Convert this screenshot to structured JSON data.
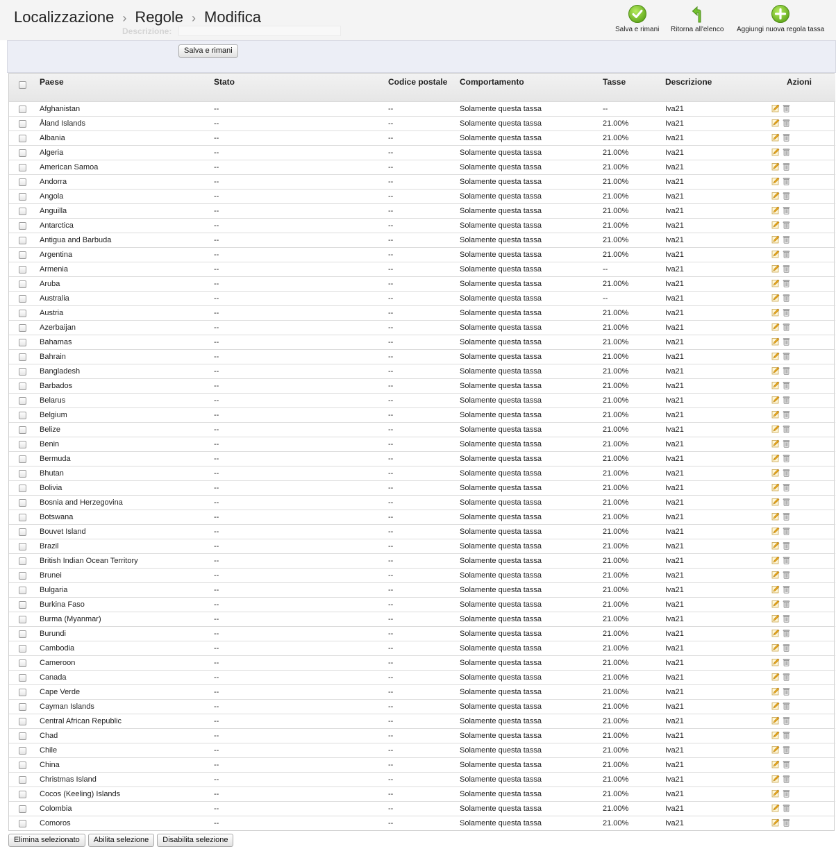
{
  "header": {
    "ghost_field_label": "Descrizione:",
    "breadcrumb": [
      "Localizzazione",
      "Regole",
      "Modifica"
    ],
    "separator": "›",
    "toolbar": [
      {
        "label": "Salva e rimani",
        "icon": "check-icon",
        "color": "#7cc427"
      },
      {
        "label": "Ritorna all'elenco",
        "icon": "back-arrow-icon",
        "color": "#6ab82a"
      },
      {
        "label": "Aggiungi nuova regola tassa",
        "icon": "plus-circle-icon",
        "color": "#7cc427"
      }
    ]
  },
  "form": {
    "save_button": "Salva e rimani"
  },
  "table": {
    "headers": {
      "country": "Paese",
      "state": "Stato",
      "zip": "Codice postale",
      "behavior": "Comportamento",
      "tax": "Tasse",
      "description": "Descrizione",
      "actions": "Azioni"
    },
    "rows": [
      {
        "country": "Afghanistan",
        "state": "--",
        "zip": "--",
        "behavior": "Solamente questa tassa",
        "tax": "--",
        "description": "Iva21"
      },
      {
        "country": "Åland Islands",
        "state": "--",
        "zip": "--",
        "behavior": "Solamente questa tassa",
        "tax": "21.00%",
        "description": "Iva21"
      },
      {
        "country": "Albania",
        "state": "--",
        "zip": "--",
        "behavior": "Solamente questa tassa",
        "tax": "21.00%",
        "description": "Iva21"
      },
      {
        "country": "Algeria",
        "state": "--",
        "zip": "--",
        "behavior": "Solamente questa tassa",
        "tax": "21.00%",
        "description": "Iva21"
      },
      {
        "country": "American Samoa",
        "state": "--",
        "zip": "--",
        "behavior": "Solamente questa tassa",
        "tax": "21.00%",
        "description": "Iva21"
      },
      {
        "country": "Andorra",
        "state": "--",
        "zip": "--",
        "behavior": "Solamente questa tassa",
        "tax": "21.00%",
        "description": "Iva21"
      },
      {
        "country": "Angola",
        "state": "--",
        "zip": "--",
        "behavior": "Solamente questa tassa",
        "tax": "21.00%",
        "description": "Iva21"
      },
      {
        "country": "Anguilla",
        "state": "--",
        "zip": "--",
        "behavior": "Solamente questa tassa",
        "tax": "21.00%",
        "description": "Iva21"
      },
      {
        "country": "Antarctica",
        "state": "--",
        "zip": "--",
        "behavior": "Solamente questa tassa",
        "tax": "21.00%",
        "description": "Iva21"
      },
      {
        "country": "Antigua and Barbuda",
        "state": "--",
        "zip": "--",
        "behavior": "Solamente questa tassa",
        "tax": "21.00%",
        "description": "Iva21"
      },
      {
        "country": "Argentina",
        "state": "--",
        "zip": "--",
        "behavior": "Solamente questa tassa",
        "tax": "21.00%",
        "description": "Iva21"
      },
      {
        "country": "Armenia",
        "state": "--",
        "zip": "--",
        "behavior": "Solamente questa tassa",
        "tax": "--",
        "description": "Iva21"
      },
      {
        "country": "Aruba",
        "state": "--",
        "zip": "--",
        "behavior": "Solamente questa tassa",
        "tax": "21.00%",
        "description": "Iva21"
      },
      {
        "country": "Australia",
        "state": "--",
        "zip": "--",
        "behavior": "Solamente questa tassa",
        "tax": "--",
        "description": "Iva21"
      },
      {
        "country": "Austria",
        "state": "--",
        "zip": "--",
        "behavior": "Solamente questa tassa",
        "tax": "21.00%",
        "description": "Iva21"
      },
      {
        "country": "Azerbaijan",
        "state": "--",
        "zip": "--",
        "behavior": "Solamente questa tassa",
        "tax": "21.00%",
        "description": "Iva21"
      },
      {
        "country": "Bahamas",
        "state": "--",
        "zip": "--",
        "behavior": "Solamente questa tassa",
        "tax": "21.00%",
        "description": "Iva21"
      },
      {
        "country": "Bahrain",
        "state": "--",
        "zip": "--",
        "behavior": "Solamente questa tassa",
        "tax": "21.00%",
        "description": "Iva21"
      },
      {
        "country": "Bangladesh",
        "state": "--",
        "zip": "--",
        "behavior": "Solamente questa tassa",
        "tax": "21.00%",
        "description": "Iva21"
      },
      {
        "country": "Barbados",
        "state": "--",
        "zip": "--",
        "behavior": "Solamente questa tassa",
        "tax": "21.00%",
        "description": "Iva21"
      },
      {
        "country": "Belarus",
        "state": "--",
        "zip": "--",
        "behavior": "Solamente questa tassa",
        "tax": "21.00%",
        "description": "Iva21"
      },
      {
        "country": "Belgium",
        "state": "--",
        "zip": "--",
        "behavior": "Solamente questa tassa",
        "tax": "21.00%",
        "description": "Iva21"
      },
      {
        "country": "Belize",
        "state": "--",
        "zip": "--",
        "behavior": "Solamente questa tassa",
        "tax": "21.00%",
        "description": "Iva21"
      },
      {
        "country": "Benin",
        "state": "--",
        "zip": "--",
        "behavior": "Solamente questa tassa",
        "tax": "21.00%",
        "description": "Iva21"
      },
      {
        "country": "Bermuda",
        "state": "--",
        "zip": "--",
        "behavior": "Solamente questa tassa",
        "tax": "21.00%",
        "description": "Iva21"
      },
      {
        "country": "Bhutan",
        "state": "--",
        "zip": "--",
        "behavior": "Solamente questa tassa",
        "tax": "21.00%",
        "description": "Iva21"
      },
      {
        "country": "Bolivia",
        "state": "--",
        "zip": "--",
        "behavior": "Solamente questa tassa",
        "tax": "21.00%",
        "description": "Iva21"
      },
      {
        "country": "Bosnia and Herzegovina",
        "state": "--",
        "zip": "--",
        "behavior": "Solamente questa tassa",
        "tax": "21.00%",
        "description": "Iva21"
      },
      {
        "country": "Botswana",
        "state": "--",
        "zip": "--",
        "behavior": "Solamente questa tassa",
        "tax": "21.00%",
        "description": "Iva21"
      },
      {
        "country": "Bouvet Island",
        "state": "--",
        "zip": "--",
        "behavior": "Solamente questa tassa",
        "tax": "21.00%",
        "description": "Iva21"
      },
      {
        "country": "Brazil",
        "state": "--",
        "zip": "--",
        "behavior": "Solamente questa tassa",
        "tax": "21.00%",
        "description": "Iva21"
      },
      {
        "country": "British Indian Ocean Territory",
        "state": "--",
        "zip": "--",
        "behavior": "Solamente questa tassa",
        "tax": "21.00%",
        "description": "Iva21"
      },
      {
        "country": "Brunei",
        "state": "--",
        "zip": "--",
        "behavior": "Solamente questa tassa",
        "tax": "21.00%",
        "description": "Iva21"
      },
      {
        "country": "Bulgaria",
        "state": "--",
        "zip": "--",
        "behavior": "Solamente questa tassa",
        "tax": "21.00%",
        "description": "Iva21"
      },
      {
        "country": "Burkina Faso",
        "state": "--",
        "zip": "--",
        "behavior": "Solamente questa tassa",
        "tax": "21.00%",
        "description": "Iva21"
      },
      {
        "country": "Burma (Myanmar)",
        "state": "--",
        "zip": "--",
        "behavior": "Solamente questa tassa",
        "tax": "21.00%",
        "description": "Iva21"
      },
      {
        "country": "Burundi",
        "state": "--",
        "zip": "--",
        "behavior": "Solamente questa tassa",
        "tax": "21.00%",
        "description": "Iva21"
      },
      {
        "country": "Cambodia",
        "state": "--",
        "zip": "--",
        "behavior": "Solamente questa tassa",
        "tax": "21.00%",
        "description": "Iva21"
      },
      {
        "country": "Cameroon",
        "state": "--",
        "zip": "--",
        "behavior": "Solamente questa tassa",
        "tax": "21.00%",
        "description": "Iva21"
      },
      {
        "country": "Canada",
        "state": "--",
        "zip": "--",
        "behavior": "Solamente questa tassa",
        "tax": "21.00%",
        "description": "Iva21"
      },
      {
        "country": "Cape Verde",
        "state": "--",
        "zip": "--",
        "behavior": "Solamente questa tassa",
        "tax": "21.00%",
        "description": "Iva21"
      },
      {
        "country": "Cayman Islands",
        "state": "--",
        "zip": "--",
        "behavior": "Solamente questa tassa",
        "tax": "21.00%",
        "description": "Iva21"
      },
      {
        "country": "Central African Republic",
        "state": "--",
        "zip": "--",
        "behavior": "Solamente questa tassa",
        "tax": "21.00%",
        "description": "Iva21"
      },
      {
        "country": "Chad",
        "state": "--",
        "zip": "--",
        "behavior": "Solamente questa tassa",
        "tax": "21.00%",
        "description": "Iva21"
      },
      {
        "country": "Chile",
        "state": "--",
        "zip": "--",
        "behavior": "Solamente questa tassa",
        "tax": "21.00%",
        "description": "Iva21"
      },
      {
        "country": "China",
        "state": "--",
        "zip": "--",
        "behavior": "Solamente questa tassa",
        "tax": "21.00%",
        "description": "Iva21"
      },
      {
        "country": "Christmas Island",
        "state": "--",
        "zip": "--",
        "behavior": "Solamente questa tassa",
        "tax": "21.00%",
        "description": "Iva21"
      },
      {
        "country": "Cocos (Keeling) Islands",
        "state": "--",
        "zip": "--",
        "behavior": "Solamente questa tassa",
        "tax": "21.00%",
        "description": "Iva21"
      },
      {
        "country": "Colombia",
        "state": "--",
        "zip": "--",
        "behavior": "Solamente questa tassa",
        "tax": "21.00%",
        "description": "Iva21"
      },
      {
        "country": "Comoros",
        "state": "--",
        "zip": "--",
        "behavior": "Solamente questa tassa",
        "tax": "21.00%",
        "description": "Iva21"
      }
    ],
    "row_actions": [
      "edit-icon",
      "delete-icon"
    ]
  },
  "bulk_actions": {
    "delete": "Elimina selezionato",
    "enable": "Abilita selezione",
    "disable": "Disabilita selezione"
  }
}
